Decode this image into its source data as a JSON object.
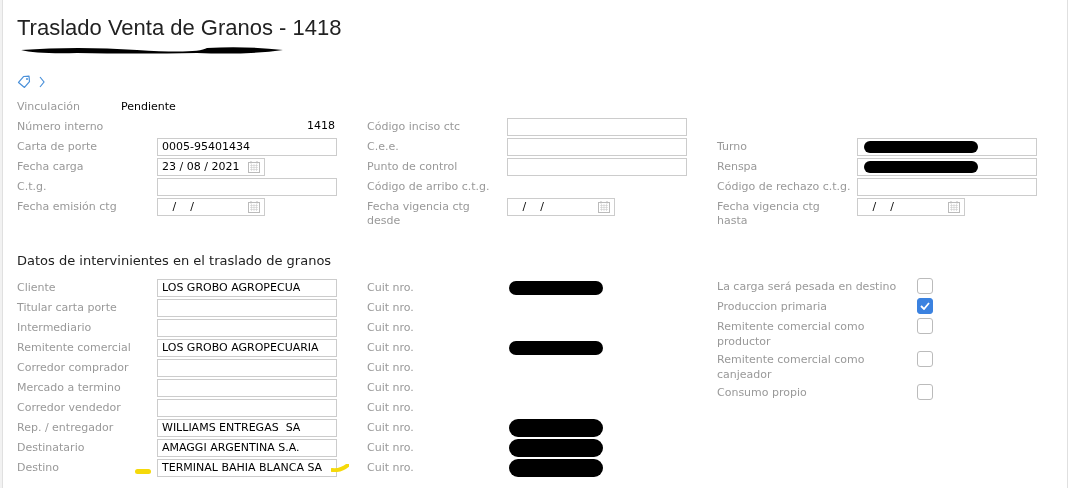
{
  "title": "Traslado Venta de Granos - 1418",
  "subtitle": {
    "redacted": true
  },
  "general_rows": [
    [
      {
        "label": "Vinculación",
        "field": {
          "kind": "status",
          "value": "Pendiente"
        }
      },
      null,
      null
    ],
    [
      {
        "label": "Número interno",
        "field": {
          "kind": "number",
          "value": "1418"
        }
      },
      {
        "label": "Código inciso ctc",
        "field": {
          "kind": "input"
        }
      },
      null
    ],
    [
      {
        "label": "Carta de porte",
        "field": {
          "kind": "input",
          "value": "0005-95401434"
        }
      },
      {
        "label": "C.e.e.",
        "field": {
          "kind": "input"
        }
      },
      {
        "label": "Turno",
        "field": {
          "kind": "input",
          "redacted": true
        }
      }
    ],
    [
      {
        "label": "Fecha carga",
        "field": {
          "kind": "date",
          "value": "23 / 08 / 2021"
        }
      },
      {
        "label": "Punto de control",
        "field": {
          "kind": "input"
        }
      },
      {
        "label": "Renspa",
        "field": {
          "kind": "input",
          "redacted": true
        }
      }
    ],
    [
      {
        "label": "C.t.g.",
        "field": {
          "kind": "input"
        }
      },
      {
        "label": "Código de arribo c.t.g.",
        "field": {
          "kind": "none"
        }
      },
      {
        "label": "Código de rechazo c.t.g.",
        "field": {
          "kind": "input"
        }
      }
    ],
    [
      {
        "label": "Fecha emisión ctg",
        "field": {
          "kind": "date",
          "value": "   /    /"
        }
      },
      {
        "label": "Fecha vigencia ctg desde",
        "field": {
          "kind": "date",
          "value": "   /    /"
        }
      },
      {
        "label": "Fecha vigencia ctg hasta",
        "field": {
          "kind": "date",
          "value": "   /    /"
        }
      }
    ]
  ],
  "section_title": "Datos de intervinientes en el traslado de granos",
  "parties": [
    {
      "label": "Cliente",
      "value": "LOS GROBO AGROPECUA",
      "cuit_label": "Cuit nro.",
      "cuit_redacted": true
    },
    {
      "label": "Titular carta porte",
      "cuit_label": "Cuit nro.",
      "cuit_redacted": false
    },
    {
      "label": "Intermediario",
      "cuit_label": "Cuit nro.",
      "cuit_redacted": false
    },
    {
      "label": "Remitente comercial",
      "value": "LOS GROBO AGROPECUARIA",
      "cuit_label": "Cuit nro.",
      "cuit_redacted": true
    },
    {
      "label": "Corredor comprador",
      "cuit_label": "Cuit nro.",
      "cuit_redacted": false
    },
    {
      "label": "Mercado a termino",
      "cuit_label": "Cuit nro.",
      "cuit_redacted": false
    },
    {
      "label": "Corredor vendedor",
      "cuit_label": "Cuit nro.",
      "cuit_redacted": false
    },
    {
      "label": "Rep. / entregador",
      "value": "WILLIAMS ENTREGAS  SA",
      "cuit_label": "Cuit nro.",
      "cuit_redacted": true
    },
    {
      "label": "Destinatario",
      "value": "AMAGGI ARGENTINA S.A.",
      "cuit_label": "Cuit nro.",
      "cuit_redacted": true
    },
    {
      "label": "Destino",
      "value": "TERMINAL BAHIA BLANCA SA",
      "cuit_label": "Cuit nro.",
      "cuit_redacted": true,
      "highlighted": true
    }
  ],
  "options": [
    {
      "label": "La carga será pesada en destino",
      "checked": false
    },
    {
      "label": "Produccion primaria",
      "checked": true
    },
    {
      "label": "Remitente comercial como productor",
      "checked": false
    },
    {
      "label": "Remitente comercial como canjeador",
      "checked": false
    },
    {
      "label": "Consumo propio",
      "checked": false
    }
  ]
}
